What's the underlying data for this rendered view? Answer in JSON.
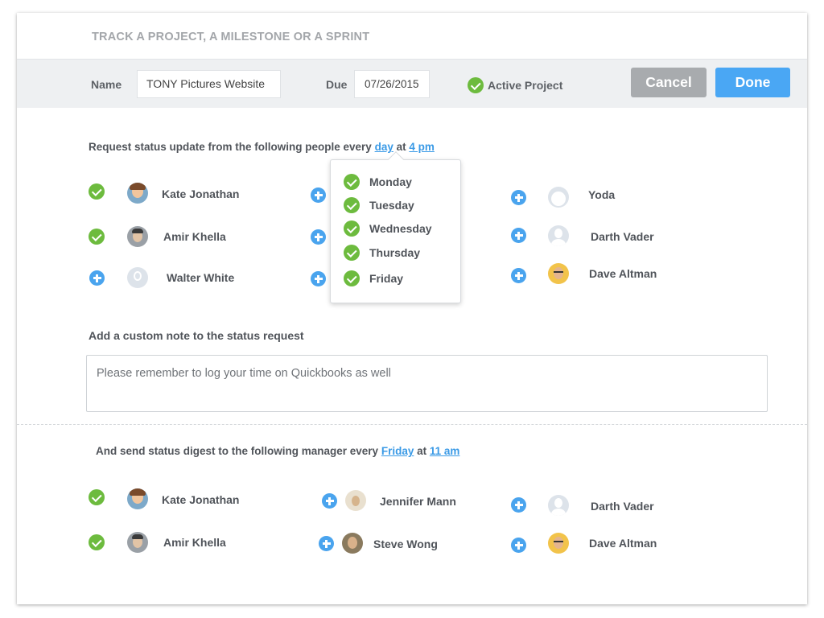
{
  "header": {
    "title": "TRACK A PROJECT, A MILESTONE OR A SPRINT"
  },
  "toolbar": {
    "name_label": "Name",
    "name_value": "TONY Pictures Website",
    "due_label": "Due",
    "due_value": "07/26/2015",
    "active_label": "Active Project",
    "cancel_label": "Cancel",
    "done_label": "Done",
    "cancel_color": "#a8abae",
    "done_color": "#4aa7f4"
  },
  "status_request": {
    "prefix": "Request status update from the following people every",
    "frequency": "day",
    "at": "at",
    "time": "4 pm",
    "people": [
      {
        "name": "Kate Jonathan",
        "selected": true
      },
      {
        "name": "Amir Khella",
        "selected": true
      },
      {
        "name": "Walter White",
        "selected": false
      },
      {
        "name": "Yoda",
        "selected": false
      },
      {
        "name": "Darth Vader",
        "selected": false
      },
      {
        "name": "Dave Altman",
        "selected": false
      }
    ]
  },
  "day_picker": {
    "days": [
      {
        "label": "Monday",
        "checked": true
      },
      {
        "label": "Tuesday",
        "checked": true
      },
      {
        "label": "Wednesday",
        "checked": true
      },
      {
        "label": "Thursday",
        "checked": true
      },
      {
        "label": "Friday",
        "checked": true
      }
    ]
  },
  "note": {
    "label": "Add a custom note to the status request",
    "value": "Please remember to log your time on Quickbooks as well"
  },
  "digest": {
    "prefix": "And send status digest to the following manager every",
    "frequency": "Friday",
    "at": "at",
    "time": "11 am",
    "people": [
      {
        "name": "Kate Jonathan",
        "selected": true
      },
      {
        "name": "Amir Khella",
        "selected": true
      },
      {
        "name": "Jennifer Mann",
        "selected": false
      },
      {
        "name": "Steve Wong",
        "selected": false
      },
      {
        "name": "Darth Vader",
        "selected": false
      },
      {
        "name": "Dave Altman",
        "selected": false
      }
    ]
  },
  "colors": {
    "check_green": "#6dbb3e",
    "plus_blue": "#4aa4ee",
    "link_blue": "#3a9ae6"
  }
}
